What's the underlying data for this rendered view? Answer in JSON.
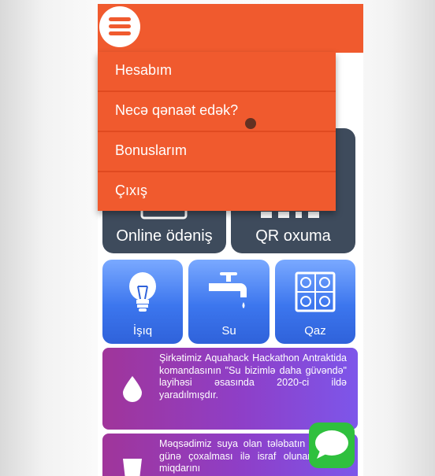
{
  "menu": {
    "items": [
      {
        "label": "Hesabım"
      },
      {
        "label": "Necə qənaət edək?"
      },
      {
        "label": "Bonuslarım"
      },
      {
        "label": "Çıxış"
      }
    ]
  },
  "tiles": {
    "online_payment": "Online ödəniş",
    "qr": "QR oxuma",
    "electricity": "İşıq",
    "water": "Su",
    "gas": "Qaz"
  },
  "cards": [
    {
      "text": "Şirkətimiz Aquahack Hackathon Antraktida komandasının \"Su bizimlə daha güvəndə\" layihəsi əsasında 2020-ci ildə yaradılmışdır.",
      "icon": "water-drop-icon"
    },
    {
      "text": "Məqsədimiz suya olan tələbatın gündən-günə çoxalması ilə israf olunan suyun miqdarını",
      "icon": "glass-icon"
    }
  ],
  "colors": {
    "header": "#f05a2e",
    "dark_tile": "#3e4b5c",
    "blue_tile": "#3c76ee",
    "card": "#9a3aaa",
    "chat": "#2fc03e"
  }
}
